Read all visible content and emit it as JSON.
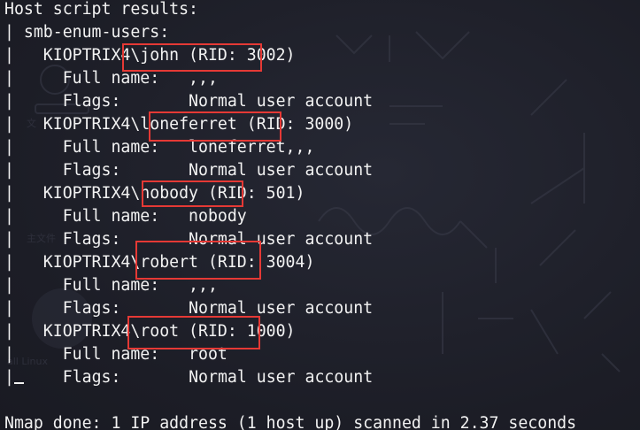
{
  "terminal": {
    "lines": [
      "Host script results:",
      "| smb-enum-users:",
      "|   KIOPTRIX4\\john (RID: 3002)",
      "|     Full name:   ,,,",
      "|     Flags:       Normal user account",
      "|   KIOPTRIX4\\loneferret (RID: 3000)",
      "|     Full name:   loneferret,,,",
      "|     Flags:       Normal user account",
      "|   KIOPTRIX4\\nobody (RID: 501)",
      "|     Full name:   nobody",
      "|     Flags:       Normal user account",
      "|   KIOPTRIX4\\robert (RID: 3004)",
      "|     Full name:   ,,,",
      "|     Flags:       Normal user account",
      "|   KIOPTRIX4\\root (RID: 1000)",
      "|     Full name:   root",
      "|     Flags:       Normal user account",
      "",
      "Nmap done: 1 IP address (1 host up) scanned in 2.37 seconds"
    ],
    "last_result_prefix": "|",
    "highlight_color": "#e53935",
    "text_color": "#f2f2f2",
    "background_color": "#1e1f29"
  }
}
